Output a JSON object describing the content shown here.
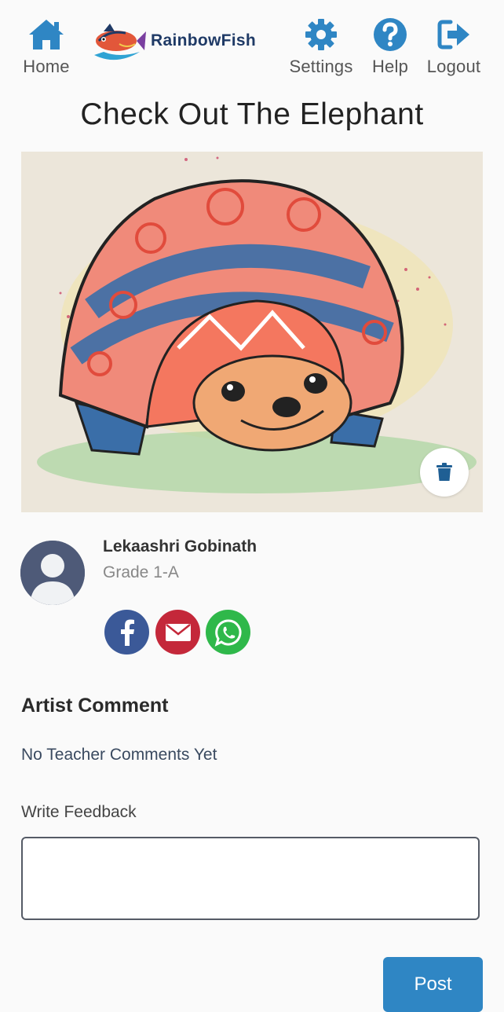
{
  "header": {
    "home_label": "Home",
    "brand_name": "RainbowFish",
    "settings_label": "Settings",
    "help_label": "Help",
    "logout_label": "Logout"
  },
  "page": {
    "title": "Check Out The Elephant"
  },
  "artist": {
    "name": "Lekaashri Gobinath",
    "grade": "Grade 1-A"
  },
  "share": {
    "icons": [
      "facebook-icon",
      "email-icon",
      "whatsapp-icon"
    ]
  },
  "comments": {
    "section_title": "Artist Comment",
    "empty_text": "No Teacher Comments Yet"
  },
  "feedback": {
    "label": "Write Feedback",
    "value": "",
    "post_label": "Post"
  },
  "colors": {
    "accent": "#2f86c4",
    "facebook": "#3b5998",
    "email": "#c4283a",
    "whatsapp": "#2fb84a"
  }
}
